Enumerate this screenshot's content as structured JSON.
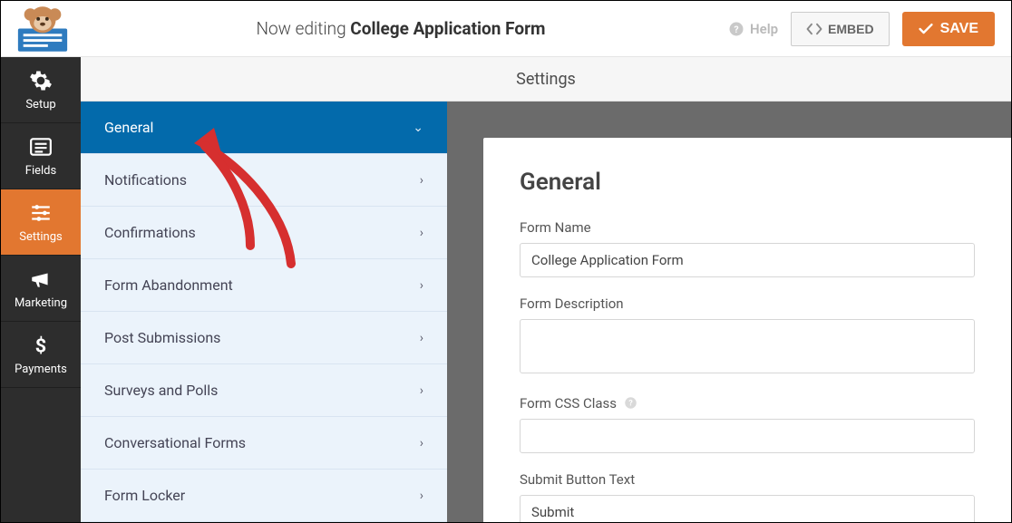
{
  "header": {
    "editing_prefix": "Now editing",
    "form_title": "College Application Form",
    "help_label": "Help",
    "embed_label": "EMBED",
    "save_label": "SAVE"
  },
  "rail": [
    {
      "key": "setup",
      "label": "Setup"
    },
    {
      "key": "fields",
      "label": "Fields"
    },
    {
      "key": "settings",
      "label": "Settings",
      "active": true
    },
    {
      "key": "marketing",
      "label": "Marketing"
    },
    {
      "key": "payments",
      "label": "Payments"
    }
  ],
  "subheader": "Settings",
  "settings_nav": [
    {
      "label": "General",
      "active": true
    },
    {
      "label": "Notifications"
    },
    {
      "label": "Confirmations"
    },
    {
      "label": "Form Abandonment"
    },
    {
      "label": "Post Submissions"
    },
    {
      "label": "Surveys and Polls"
    },
    {
      "label": "Conversational Forms"
    },
    {
      "label": "Form Locker"
    }
  ],
  "panel": {
    "heading": "General",
    "fields": {
      "form_name": {
        "label": "Form Name",
        "value": "College Application Form"
      },
      "form_description": {
        "label": "Form Description",
        "value": ""
      },
      "css_class": {
        "label": "Form CSS Class",
        "value": "",
        "has_hint": true
      },
      "submit_text": {
        "label": "Submit Button Text",
        "value": "Submit"
      }
    }
  }
}
